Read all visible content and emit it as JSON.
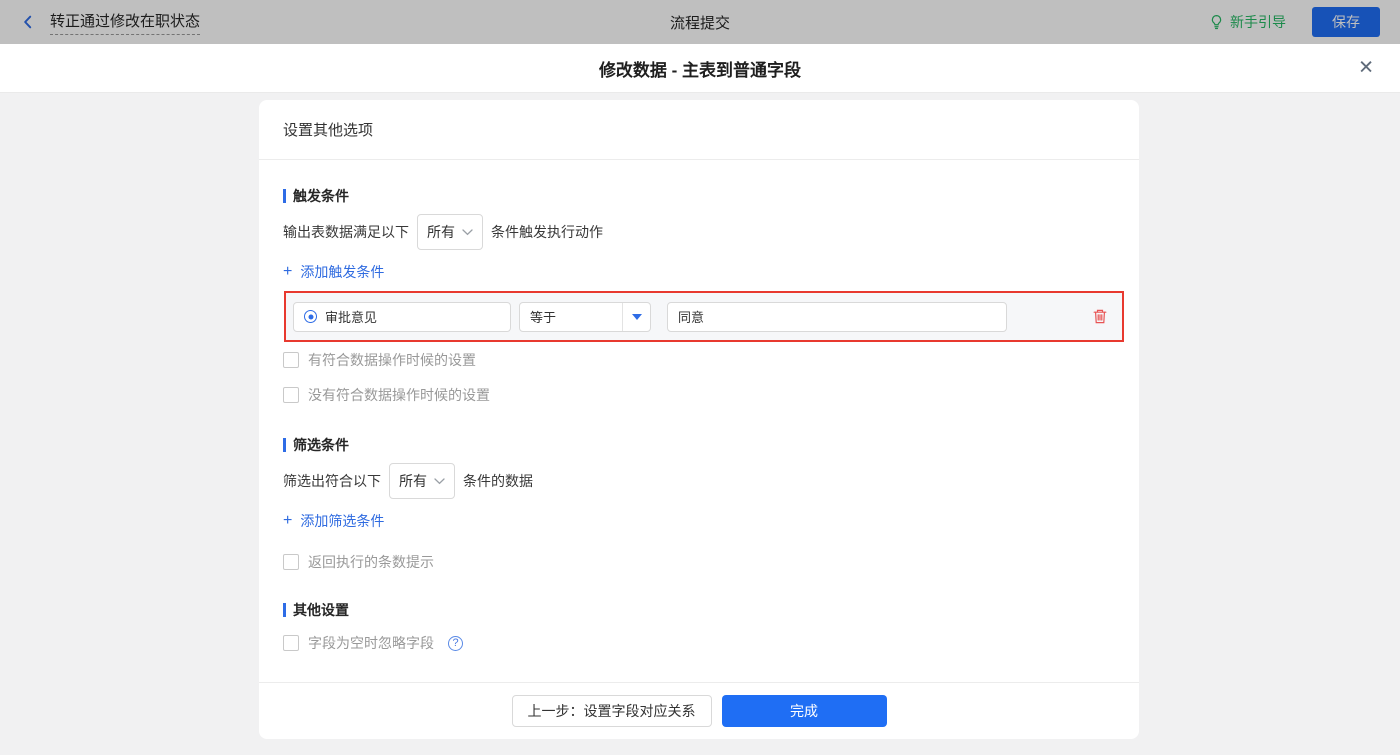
{
  "colors": {
    "accent": "#1f6ef4",
    "section_bar": "#2e6ce6",
    "guide_green": "#26b864",
    "danger_red": "#e8392f"
  },
  "app_bar": {
    "title": "转正通过修改在职状态",
    "center_title": "流程提交",
    "guide_label": "新手引导",
    "save_label": "保存"
  },
  "modal": {
    "title": "修改数据 - 主表到普通字段"
  },
  "panel": {
    "header": "设置其他选项",
    "trigger": {
      "title": "触发条件",
      "prefix": "输出表数据满足以下",
      "match_mode": "所有",
      "suffix": "条件触发执行动作",
      "add_label": "添加触发条件",
      "condition": {
        "field": "审批意见",
        "operator": "等于",
        "value": "同意"
      },
      "checkboxes": [
        "有符合数据操作时候的设置",
        "没有符合数据操作时候的设置"
      ]
    },
    "filter": {
      "title": "筛选条件",
      "prefix": "筛选出符合以下",
      "match_mode": "所有",
      "suffix": "条件的数据",
      "add_label": "添加筛选条件",
      "checkbox": "返回执行的条数提示"
    },
    "other": {
      "title": "其他设置",
      "checkbox": "字段为空时忽略字段"
    },
    "footer": {
      "prev_label": "上一步：设置字段对应关系",
      "done_label": "完成"
    }
  },
  "icons": {
    "plus": "+",
    "question": "?",
    "close": "✕"
  }
}
